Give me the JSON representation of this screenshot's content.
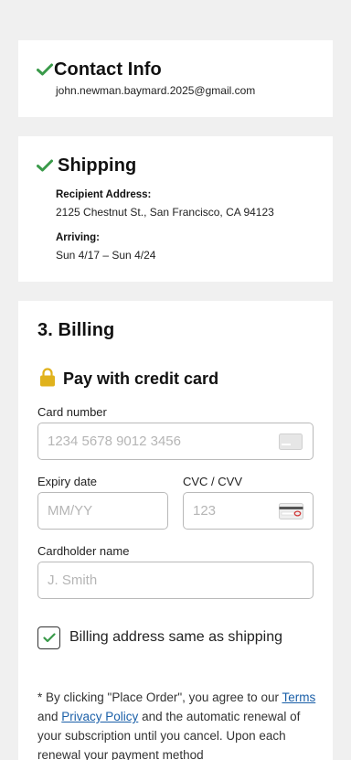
{
  "contact": {
    "title": "Contact Info",
    "email": "john.newman.baymard.2025@gmail.com"
  },
  "shipping": {
    "title": "Shipping",
    "recipient_label": "Recipient Address:",
    "recipient_value": "2125 Chestnut St., San Francisco, CA 94123",
    "arriving_label": "Arriving:",
    "arriving_value": "Sun 4/17 – Sun 4/24"
  },
  "billing": {
    "title": "3. Billing",
    "pay_title": "Pay with credit card",
    "card_number_label": "Card number",
    "card_number_placeholder": "1234 5678 9012 3456",
    "expiry_label": "Expiry date",
    "expiry_placeholder": "MM/YY",
    "cvc_label": "CVC / CVV",
    "cvc_placeholder": "123",
    "cardholder_label": "Cardholder name",
    "cardholder_placeholder": "J. Smith",
    "same_address_label": "Billing address same as shipping",
    "same_address_checked": true
  },
  "legal": {
    "prefix": "* By clicking \"Place Order\", you agree to our ",
    "terms_link": "Terms",
    "and_text": " and ",
    "privacy_link": "Privacy Policy",
    "suffix": " and the automatic renewal of your subscription until you cancel. Upon each renewal your payment method"
  },
  "colors": {
    "check_green": "#3a9a4a",
    "lock_gold": "#e0b21c",
    "link_blue": "#1a5fa8"
  }
}
